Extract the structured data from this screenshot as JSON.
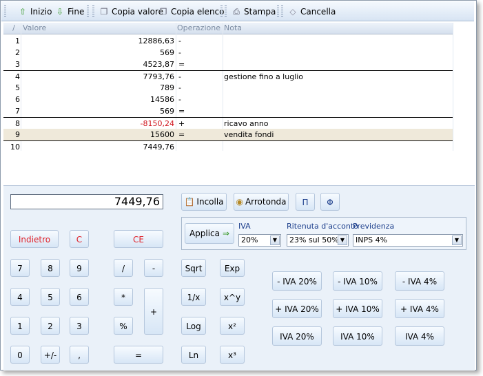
{
  "toolbar": {
    "inizio": "Inizio",
    "fine": "Fine",
    "copia_valore": "Copia valore",
    "copia_elenco": "Copia elenco",
    "stampa": "Stampa",
    "cancella": "Cancella"
  },
  "grid": {
    "headers": {
      "num": "/",
      "valore": "Valore",
      "operazione": "Operazione",
      "nota": "Nota"
    },
    "rows": [
      {
        "n": "1",
        "v": "12886,63",
        "o": "-",
        "t": ""
      },
      {
        "n": "2",
        "v": "569",
        "o": "-",
        "t": ""
      },
      {
        "n": "3",
        "v": "4523,87",
        "o": "=",
        "t": ""
      },
      {
        "n": "4",
        "v": "7793,76",
        "o": "-",
        "t": "gestione fino a luglio"
      },
      {
        "n": "5",
        "v": "789",
        "o": "-",
        "t": ""
      },
      {
        "n": "6",
        "v": "14586",
        "o": "-",
        "t": ""
      },
      {
        "n": "7",
        "v": "569",
        "o": "=",
        "t": ""
      },
      {
        "n": "8",
        "v": "-8150,24",
        "o": "+",
        "t": "ricavo anno"
      },
      {
        "n": "9",
        "v": "15600",
        "o": "=",
        "t": "vendita fondi"
      },
      {
        "n": "10",
        "v": "7449,76",
        "o": "",
        "t": ""
      }
    ]
  },
  "display": "7449,76",
  "actions": {
    "incolla": "Incolla",
    "arrotonda": "Arrotonda",
    "pi": "Π",
    "phi": "Φ"
  },
  "tax": {
    "applica": "Applica",
    "iva_label": "IVA",
    "iva_value": "20%",
    "ritenuta_label": "Ritenuta d'acconto",
    "ritenuta_value": "23% sul 50%",
    "previdenza_label": "Previdenza",
    "previdenza_value": "INPS 4%"
  },
  "keys": {
    "indietro": "Indietro",
    "c": "C",
    "ce": "CE",
    "k7": "7",
    "k8": "8",
    "k9": "9",
    "k4": "4",
    "k5": "5",
    "k6": "6",
    "k1": "1",
    "k2": "2",
    "k3": "3",
    "k0": "0",
    "sign": "+/-",
    "comma": ",",
    "div": "/",
    "minus": "-",
    "mul": "*",
    "plus": "+",
    "perc": "%",
    "eq": "=",
    "sqrt": "Sqrt",
    "exp": "Exp",
    "inv": "1/x",
    "pow": "x^y",
    "log": "Log",
    "sq": "x²",
    "ln": "Ln",
    "cube": "x³"
  },
  "iva_buttons": {
    "m20": "- IVA 20%",
    "m10": "- IVA 10%",
    "m4": "- IVA 4%",
    "p20": "+ IVA 20%",
    "p10": "+ IVA 10%",
    "p4": "+ IVA 4%",
    "i20": "IVA 20%",
    "i10": "IVA 10%",
    "i4": "IVA 4%"
  },
  "colors": {
    "negative": "#d0141c",
    "selected_row": "#efe9da",
    "accent_label": "#1d3f8c"
  }
}
